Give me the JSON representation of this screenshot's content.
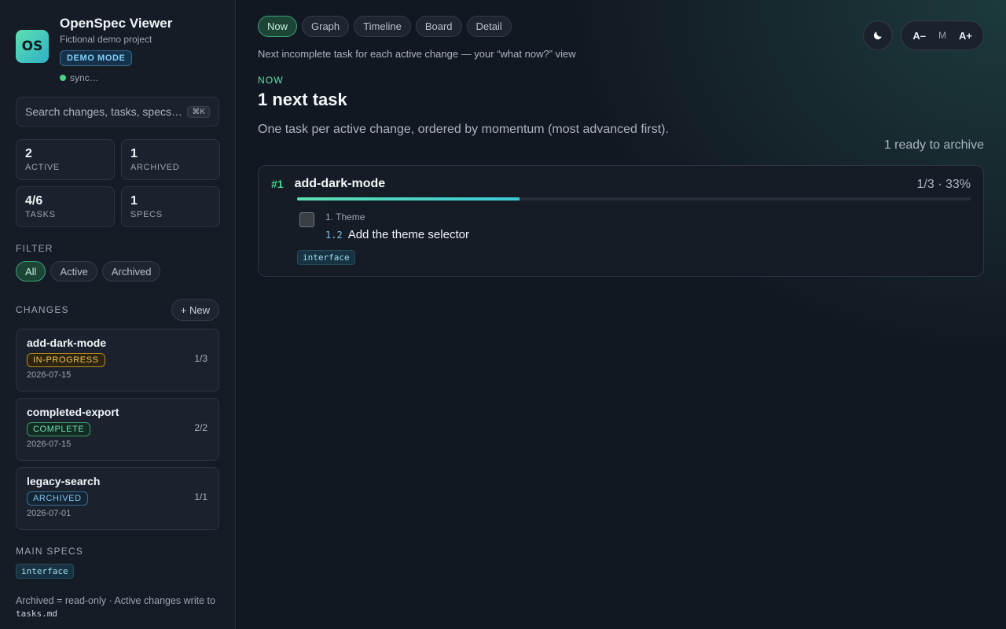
{
  "app": {
    "logo_text": "OS",
    "title": "OpenSpec Viewer",
    "subtitle": "Fictional demo project",
    "mode_badge": "DEMO MODE",
    "sync_status": "sync…"
  },
  "search": {
    "placeholder": "Search changes, tasks, specs…",
    "shortcut": "⌘K"
  },
  "stats": [
    {
      "value": "2",
      "label": "ACTIVE"
    },
    {
      "value": "1",
      "label": "ARCHIVED"
    },
    {
      "value": "4/6",
      "label": "TASKS"
    },
    {
      "value": "1",
      "label": "SPECS"
    }
  ],
  "filter": {
    "label": "FILTER",
    "options": [
      "All",
      "Active",
      "Archived"
    ],
    "selected": "All"
  },
  "changes": {
    "label": "CHANGES",
    "new_label": "+ New",
    "items": [
      {
        "name": "add-dark-mode",
        "status": "IN-PROGRESS",
        "date": "2026-07-15",
        "count": "1/3"
      },
      {
        "name": "completed-export",
        "status": "COMPLETE",
        "date": "2026-07-15",
        "count": "2/2"
      },
      {
        "name": "legacy-search",
        "status": "ARCHIVED",
        "date": "2026-07-01",
        "count": "1/1"
      }
    ]
  },
  "main_specs": {
    "label": "MAIN SPECS",
    "items": [
      "interface"
    ]
  },
  "footnote": {
    "text": "Archived = read-only · Active changes write to",
    "file": "tasks.md"
  },
  "tabs": [
    "Now",
    "Graph",
    "Timeline",
    "Board",
    "Detail"
  ],
  "active_tab": "Now",
  "view_description": "Next incomplete task for each active change — your “what now?” view",
  "font_controls": {
    "decrease": "A–",
    "current": "M",
    "increase": "A+"
  },
  "theme_icon": "moon-icon",
  "now_view": {
    "eyebrow": "NOW",
    "heading": "1 next task",
    "subheading": "One task per active change, ordered by momentum (most advanced first).",
    "ready_to_archive": "1 ready to archive",
    "tasks": [
      {
        "rank": "#1",
        "change": "add-dark-mode",
        "progress_text": "1/3 · 33%",
        "progress_fraction": 0.33,
        "group": "1. Theme",
        "task_id": "1.2",
        "task_title": "Add the theme selector",
        "tag": "interface"
      }
    ]
  },
  "colors": {
    "accent": "#5ee0b0",
    "status_in_progress": "#f1c24a",
    "status_complete": "#6fe3b0",
    "status_archived": "#7fc4f0"
  }
}
